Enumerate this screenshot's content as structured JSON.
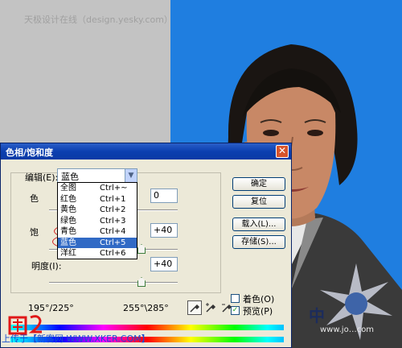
{
  "watermark_top": "天极设计在线（design.yesky.com）受校…",
  "dialog": {
    "title": "色相/饱和度",
    "close_glyph": "✕",
    "edit_label": "编辑(E):",
    "edit_value": "蓝色",
    "hue_label_fragment": "色",
    "saturation_label_fragment": "饱",
    "lightness_label": "明度(I):",
    "hue_value": "0",
    "saturation_value": "+40",
    "lightness_value": "+40",
    "dropdown": [
      {
        "label": "全图",
        "shortcut": "Ctrl+~"
      },
      {
        "label": "红色",
        "shortcut": "Ctrl+1"
      },
      {
        "label": "黄色",
        "shortcut": "Ctrl+2"
      },
      {
        "label": "绿色",
        "shortcut": "Ctrl+3"
      },
      {
        "label": "青色",
        "shortcut": "Ctrl+4"
      },
      {
        "label": "蓝色",
        "shortcut": "Ctrl+5",
        "selected": true
      },
      {
        "label": "洋红",
        "shortcut": "Ctrl+6"
      }
    ],
    "buttons": {
      "ok": "确定",
      "reset": "复位",
      "load": "载入(L)...",
      "save": "存储(S)..."
    },
    "colorize_label": "着色(O)",
    "preview_label": "预览(P)",
    "range_left": "195°/225°",
    "range_right": "255°\\285°"
  },
  "bottom_watermark": "上传于【新客网 WWW.XKER.COM】",
  "corner_text": "中",
  "corner_url": "www.jo…com",
  "colors": {
    "photo_background": "#1f7ee0",
    "title_bar": "#0b3fb0",
    "selection": "#316ac5",
    "annotation_red": "#d42020"
  }
}
